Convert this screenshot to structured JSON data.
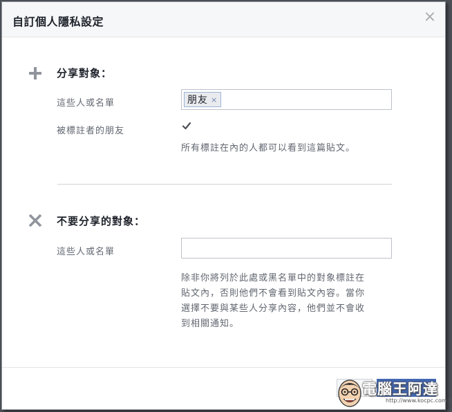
{
  "dialog": {
    "title": "自訂個人隱私設定",
    "close_glyph": "×"
  },
  "share": {
    "title": "分享對象：",
    "people_label": "這些人或名單",
    "token": "朋友",
    "token_remove": "×",
    "tagged_label": "被標註者的朋友",
    "tagged_checked": true,
    "help": "所有標註在內的人都可以看到這篇貼文。"
  },
  "exclude": {
    "title": "不要分享的對象：",
    "people_label": "這些人或名單",
    "input_value": "",
    "help_lines": [
      "除非你將列於此處或黑名單中的對象標註在",
      "貼文內，否則他們不會看到貼文內容。當你",
      "選擇不要與某些人分享內容，他們並不會收",
      "到相關通知。"
    ]
  },
  "icons": {
    "share": "plus-icon",
    "exclude": "x-icon",
    "close": "close-icon",
    "check": "checkmark-icon"
  },
  "colors": {
    "accent": "#4267b2",
    "text": "#1d2129",
    "muted": "#616770"
  },
  "watermark": {
    "text": "電腦王阿達",
    "url": "http://www.kocpc.com.tw"
  }
}
